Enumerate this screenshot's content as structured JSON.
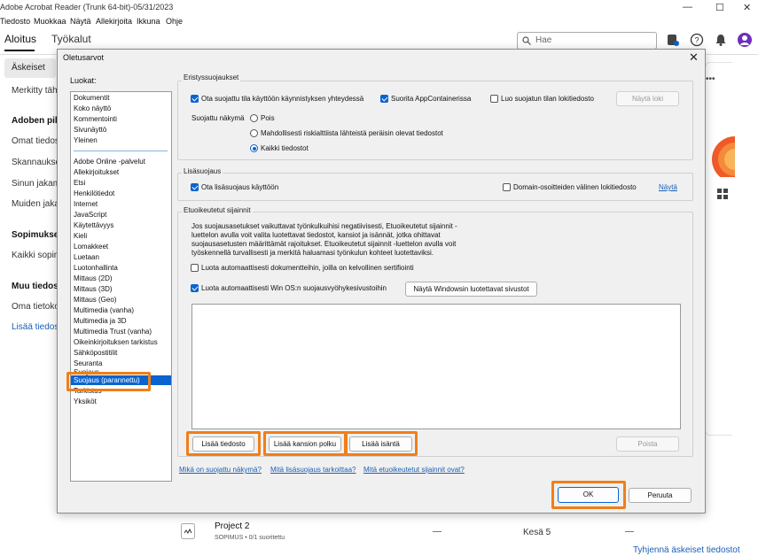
{
  "app": {
    "title": "Adobe Acrobat Reader (Trunk 64-bit)-05/31/2023",
    "menu": [
      "Tiedosto",
      "Muokkaa",
      "Näytä",
      "Allekirjoita",
      "Ikkuna",
      "Ohje"
    ],
    "tabs": {
      "home": "Aloitus",
      "tools": "Työkalut"
    },
    "search_placeholder": "Hae",
    "window_controls": {
      "minimize": "—",
      "maximize": "☐",
      "close": "✕"
    }
  },
  "left_pane": {
    "recent": "Äskeiset",
    "starred": "Merkitty täh",
    "adobe_cloud_heading": "Adoben pilv",
    "own_files": "Omat tiedos",
    "scans": "Skannaukset",
    "shared": "Sinun jakama",
    "shared_others": "Muiden jaka",
    "agreements_heading": "Sopimukset",
    "all_agreements": "Kaikki sopim",
    "other_files_heading": "Muu tiedost",
    "own_computer": "Oma tietoko",
    "add_files": "Lisää tiedost"
  },
  "background": {
    "project_name": "Project 2",
    "project_sub": "SOPIMUS • 0/1 suoritettu",
    "dash1": "—",
    "date": "Kesä 5",
    "dash2": "—",
    "clear_recent": "Tyhjennä äskeiset tiedostot"
  },
  "dialog": {
    "title": "Oletusarvot",
    "categories_label": "Luokat:",
    "categories_top": [
      "Dokumentit",
      "Koko näyttö",
      "Kommentointi",
      "Sivunäyttö",
      "Yleinen"
    ],
    "categories": [
      "Adobe Online -palvelut",
      "Allekirjoitukset",
      "Etsi",
      "Henkilötiedot",
      "Internet",
      "JavaScript",
      "Käytettävyys",
      "Kieli",
      "Lomakkeet",
      "Luetaan",
      "Luotonhallinta",
      "Mittaus (2D)",
      "Mittaus (3D)",
      "Mittaus (Geo)",
      "Multimedia (vanha)",
      "Multimedia ja 3D",
      "Multimedia Trust (vanha)",
      "Oikeinkirjoituksen tarkistus",
      "Sähköpostitilit",
      "Seuranta",
      "Suojaus",
      "Suojaus (parannettu)",
      "Tarkistus",
      "Yksiköt"
    ],
    "selected_category": "Suojaus (parannettu)",
    "sandbox": {
      "title": "Eristyssuojaukset",
      "protected_mode_cb": "Ota suojattu tila käyttöön käynnistyksen yhteydessä",
      "protected_mode_on": true,
      "appcontainer_cb": "Suorita AppContainerissa",
      "appcontainer_on": true,
      "log_cb": "Luo suojatun tilan lokitiedosto",
      "log_on": false,
      "view_log_btn": "Näytä loki",
      "protected_view_label": "Suojattu näkymä",
      "radio_off": "Pois",
      "radio_unsafe": "Mahdollisesti riskialttiista lähteistä peräisin olevat tiedostot",
      "radio_all": "Kaikki tiedostot",
      "selected_radio": "all"
    },
    "enhanced": {
      "title": "Lisäsuojaus",
      "enable_cb": "Ota lisäsuojaus käyttöön",
      "enable_on": true,
      "cross_domain_cb": "Domain-osoitteiden välinen lokitiedosto",
      "cross_domain_on": false,
      "show_link": "Näytä"
    },
    "privileged": {
      "title": "Etuoikeutetut sijainnit",
      "description": "Jos suojausasetukset vaikuttavat työnkulkuihisi negatiivisesti, Etuoikeutetut sijainnit -luettelon avulla voit valita luotettavat tiedostot, kansiot ja isännät, jotka ohittavat suojausasetusten määrittämät rajoitukset. Etuoikeutetut sijainnit -luettelon avulla voit työskennellä turvallisesti ja merkitä haluamasi työnkulun kohteet luotettaviksi.",
      "trust_certified_cb": "Luota automaattisesti dokumentteihin, joilla on kelvollinen sertifiointi",
      "trust_certified_on": false,
      "trust_win_cb": "Luota automaattisesti Win OS:n suojausvyöhykesivustoihin",
      "trust_win_on": true,
      "show_windows_btn": "Näytä Windowsin luotettavat sivustot",
      "add_file_btn": "Lisää tiedosto",
      "add_folder_btn": "Lisää kansion polku",
      "add_host_btn": "Lisää isäntä",
      "remove_btn": "Poista"
    },
    "help_links": [
      "Mikä on suojattu näkymä?",
      "Mitä lisäsuojaus tarkoittaa?",
      "Mitä etuoikeutetut sijainnit ovat?"
    ],
    "ok_btn": "OK",
    "cancel_btn": "Peruuta",
    "close_glyph": "✕"
  },
  "colors": {
    "accent": "#0a64d0",
    "highlight": "#f07f1a",
    "link": "#1a5fb4"
  }
}
